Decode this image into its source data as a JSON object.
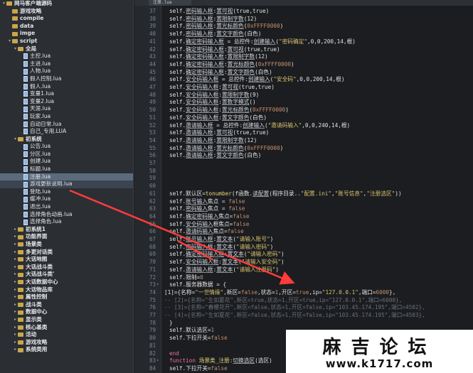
{
  "tab": {
    "label": "注册.lua"
  },
  "tree": [
    {
      "label": "网马客户端源码",
      "depth": 0,
      "type": "folder",
      "twisty": "▾",
      "bold": true
    },
    {
      "label": "游戏攻略",
      "depth": 1,
      "type": "folder",
      "twisty": "",
      "bold": true
    },
    {
      "label": "compile",
      "depth": 1,
      "type": "folder",
      "twisty": "",
      "bold": true
    },
    {
      "label": "data",
      "depth": 1,
      "type": "folder",
      "twisty": "",
      "bold": true
    },
    {
      "label": "imge",
      "depth": 1,
      "type": "folder",
      "twisty": "",
      "bold": true
    },
    {
      "label": "script",
      "depth": 1,
      "type": "folder",
      "twisty": "▾",
      "bold": true
    },
    {
      "label": "全局",
      "depth": 2,
      "type": "folder",
      "twisty": "▾",
      "bold": true
    },
    {
      "label": "主控.lua",
      "depth": 3,
      "type": "file"
    },
    {
      "label": "主进.lua",
      "depth": 3,
      "type": "file"
    },
    {
      "label": "人物.lua",
      "depth": 3,
      "type": "file"
    },
    {
      "label": "假人控制.lua",
      "depth": 3,
      "type": "file"
    },
    {
      "label": "假人.lua",
      "depth": 3,
      "type": "file"
    },
    {
      "label": "变量1.lua",
      "depth": 3,
      "type": "file"
    },
    {
      "label": "变量2.lua",
      "depth": 3,
      "type": "file"
    },
    {
      "label": "天涯.lua",
      "depth": 3,
      "type": "file"
    },
    {
      "label": "玩家.lua",
      "depth": 3,
      "type": "file"
    },
    {
      "label": "自动日常.lua",
      "depth": 3,
      "type": "file"
    },
    {
      "label": "自己_专用.LUA",
      "depth": 3,
      "type": "file"
    },
    {
      "label": "初系统",
      "depth": 2,
      "type": "folder",
      "twisty": "▾",
      "bold": true
    },
    {
      "label": "公告.lua",
      "depth": 3,
      "type": "file"
    },
    {
      "label": "分区.lua",
      "depth": 3,
      "type": "file"
    },
    {
      "label": "创建.lua",
      "depth": 3,
      "type": "file"
    },
    {
      "label": "标题.lua",
      "depth": 3,
      "type": "file"
    },
    {
      "label": "注册.lua",
      "depth": 3,
      "type": "file",
      "selected": true
    },
    {
      "label": "游戏更新说明.lua",
      "depth": 3,
      "type": "file",
      "selected2": true
    },
    {
      "label": "登陆.lua",
      "depth": 3,
      "type": "file"
    },
    {
      "label": "缓冲.lua",
      "depth": 3,
      "type": "file"
    },
    {
      "label": "退出.lua",
      "depth": 3,
      "type": "file"
    },
    {
      "label": "选择角色动画.lua",
      "depth": 3,
      "type": "file"
    },
    {
      "label": "选择角色.lua",
      "depth": 3,
      "type": "file"
    },
    {
      "label": "初系统1",
      "depth": 2,
      "type": "folder",
      "twisty": "▸",
      "bold": true
    },
    {
      "label": "功能界面",
      "depth": 2,
      "type": "folder",
      "twisty": "▸",
      "bold": true
    },
    {
      "label": "场景类",
      "depth": 2,
      "type": "folder",
      "twisty": "▸",
      "bold": true
    },
    {
      "label": "多更对话类",
      "depth": 2,
      "type": "folder",
      "twisty": "▸",
      "bold": true
    },
    {
      "label": "大话地图",
      "depth": 2,
      "type": "folder",
      "twisty": "▸",
      "bold": true
    },
    {
      "label": "大话战斗类",
      "depth": 2,
      "type": "folder",
      "twisty": "▸",
      "bold": true
    },
    {
      "label": "大话战斗类'",
      "depth": 2,
      "type": "folder",
      "twisty": "▸",
      "bold": true
    },
    {
      "label": "大话数据中心",
      "depth": 2,
      "type": "folder",
      "twisty": "▸",
      "bold": true
    },
    {
      "label": "大话物品库",
      "depth": 2,
      "type": "folder",
      "twisty": "▸",
      "bold": true
    },
    {
      "label": "属性控制",
      "depth": 2,
      "type": "folder",
      "twisty": "▸",
      "bold": true
    },
    {
      "label": "战斗类",
      "depth": 2,
      "type": "folder",
      "twisty": "▸",
      "bold": true
    },
    {
      "label": "数据中心",
      "depth": 2,
      "type": "folder",
      "twisty": "▸",
      "bold": true
    },
    {
      "label": "显示类",
      "depth": 2,
      "type": "folder",
      "twisty": "▸",
      "bold": true
    },
    {
      "label": "核心基类",
      "depth": 2,
      "type": "folder",
      "twisty": "▸",
      "bold": true
    },
    {
      "label": "活动",
      "depth": 2,
      "type": "folder",
      "twisty": "▸",
      "bold": true
    },
    {
      "label": "游戏攻略",
      "depth": 2,
      "type": "folder",
      "twisty": "▸",
      "bold": true
    },
    {
      "label": "系统类用",
      "depth": 2,
      "type": "folder",
      "twisty": "▸",
      "bold": true
    }
  ],
  "code": [
    {
      "n": "37",
      "segs": [
        [
          "self.",
          "k"
        ],
        [
          "密码输入框",
          "ul"
        ],
        [
          ":",
          "k"
        ],
        [
          "置可视",
          "ul"
        ],
        [
          "(true,true)",
          "k"
        ]
      ]
    },
    {
      "n": "38",
      "segs": [
        [
          "self.",
          "k"
        ],
        [
          "密码输入框",
          "ul"
        ],
        [
          ":",
          "k"
        ],
        [
          "置限制字数",
          "ul"
        ],
        [
          "(12)",
          "k"
        ]
      ]
    },
    {
      "n": "39",
      "segs": [
        [
          "self.",
          "k"
        ],
        [
          "密码输入框",
          "ul"
        ],
        [
          ":",
          "k"
        ],
        [
          "置光标颜色",
          "ul"
        ],
        [
          "(",
          "k"
        ],
        [
          "0xFFFF0000",
          "num"
        ],
        [
          ")",
          "k"
        ]
      ]
    },
    {
      "n": "40",
      "segs": [
        [
          "self.",
          "k"
        ],
        [
          "密码输入框",
          "ul"
        ],
        [
          ":",
          "k"
        ],
        [
          "置文字颜色",
          "ul"
        ],
        [
          "(白色)",
          "k"
        ]
      ]
    },
    {
      "n": "41",
      "segs": [
        [
          "self.",
          "k"
        ],
        [
          "确定密码输入框",
          "ul"
        ],
        [
          " = 总控件:",
          "k"
        ],
        [
          "创建输入",
          "ul"
        ],
        [
          "(",
          "k"
        ],
        [
          "\"密码确定\"",
          "str"
        ],
        [
          ",0,0,200,14,根)",
          "k"
        ]
      ]
    },
    {
      "n": "42",
      "segs": [
        [
          "self.",
          "k"
        ],
        [
          "确定密码输入框",
          "ul"
        ],
        [
          ":",
          "k"
        ],
        [
          "置可视",
          "ul"
        ],
        [
          "(true,true)",
          "k"
        ]
      ]
    },
    {
      "n": "43",
      "segs": [
        [
          "self.",
          "k"
        ],
        [
          "确定密码输入框",
          "ul"
        ],
        [
          ":",
          "k"
        ],
        [
          "置限制字数",
          "ul"
        ],
        [
          "(12)",
          "k"
        ]
      ]
    },
    {
      "n": "44",
      "segs": [
        [
          "self.",
          "k"
        ],
        [
          "确定密码输入框",
          "ul"
        ],
        [
          ":",
          "k"
        ],
        [
          "置光标颜色",
          "ul"
        ],
        [
          "(",
          "k"
        ],
        [
          "0xFFFF0000",
          "num"
        ],
        [
          ")",
          "k"
        ]
      ]
    },
    {
      "n": "45",
      "segs": [
        [
          "self.",
          "k"
        ],
        [
          "确定密码输入框",
          "ul"
        ],
        [
          ":",
          "k"
        ],
        [
          "置文字颜色",
          "ul"
        ],
        [
          "(白色)",
          "k"
        ]
      ]
    },
    {
      "n": "46",
      "segs": [
        [
          "self.",
          "k"
        ],
        [
          "安全码输入框",
          "ul"
        ],
        [
          " = 总控件:",
          "k"
        ],
        [
          "创建输入",
          "ul"
        ],
        [
          "(",
          "k"
        ],
        [
          "\"安全码\"",
          "str"
        ],
        [
          ",0,0,200,14,根)",
          "k"
        ]
      ]
    },
    {
      "n": "47",
      "segs": [
        [
          "self.",
          "k"
        ],
        [
          "安全码输入框",
          "ul"
        ],
        [
          ":",
          "k"
        ],
        [
          "置可视",
          "ul"
        ],
        [
          "(true,true)",
          "k"
        ]
      ]
    },
    {
      "n": "48",
      "segs": [
        [
          "self.",
          "k"
        ],
        [
          "安全码输入框",
          "ul"
        ],
        [
          ":",
          "k"
        ],
        [
          "置限制字数",
          "ul"
        ],
        [
          "(9)",
          "k"
        ]
      ]
    },
    {
      "n": "49",
      "segs": [
        [
          "self.",
          "k"
        ],
        [
          "安全码输入框",
          "ul"
        ],
        [
          ":",
          "k"
        ],
        [
          "置数字模式",
          "ul"
        ],
        [
          "()",
          "k"
        ]
      ]
    },
    {
      "n": "50",
      "segs": [
        [
          "self.",
          "k"
        ],
        [
          "安全码输入框",
          "ul"
        ],
        [
          ":",
          "k"
        ],
        [
          "置光标颜色",
          "ul"
        ],
        [
          "(",
          "k"
        ],
        [
          "0xFFFF0000",
          "num"
        ],
        [
          ")",
          "k"
        ]
      ]
    },
    {
      "n": "51",
      "segs": [
        [
          "self.",
          "k"
        ],
        [
          "安全码输入框",
          "ul"
        ],
        [
          ":",
          "k"
        ],
        [
          "置文字颜色",
          "ul"
        ],
        [
          "(白色)",
          "k"
        ]
      ]
    },
    {
      "n": "52",
      "segs": [
        [
          "self.",
          "k"
        ],
        [
          "邀请输入框",
          "ul"
        ],
        [
          " = 总控件:",
          "k"
        ],
        [
          "创建输入",
          "ul"
        ],
        [
          "(",
          "k"
        ],
        [
          "\"邀请码输入\"",
          "str"
        ],
        [
          ",0,0,240,14,根)",
          "k"
        ]
      ]
    },
    {
      "n": "53",
      "segs": [
        [
          "self.",
          "k"
        ],
        [
          "邀请输入框",
          "ul"
        ],
        [
          ":",
          "k"
        ],
        [
          "置可视",
          "ul"
        ],
        [
          "(true,true)",
          "k"
        ]
      ]
    },
    {
      "n": "54",
      "segs": [
        [
          "self.",
          "k"
        ],
        [
          "邀请输入框",
          "ul"
        ],
        [
          ":",
          "k"
        ],
        [
          "置限制字数",
          "ul"
        ],
        [
          "(12)",
          "k"
        ]
      ]
    },
    {
      "n": "55",
      "segs": [
        [
          "self.",
          "k"
        ],
        [
          "邀请输入框",
          "ul"
        ],
        [
          ":",
          "k"
        ],
        [
          "置光标颜色",
          "ul"
        ],
        [
          "(",
          "k"
        ],
        [
          "0xFFFF0000",
          "num"
        ],
        [
          ")",
          "k"
        ]
      ]
    },
    {
      "n": "56",
      "segs": [
        [
          "self.",
          "k"
        ],
        [
          "邀请输入框",
          "ul"
        ],
        [
          ":",
          "k"
        ],
        [
          "置文字颜色",
          "ul"
        ],
        [
          "(白色)",
          "k"
        ]
      ]
    },
    {
      "n": "57",
      "segs": []
    },
    {
      "n": "58",
      "segs": []
    },
    {
      "n": "59",
      "segs": []
    },
    {
      "n": "60",
      "segs": []
    },
    {
      "n": "61",
      "segs": [
        [
          "self.默认区=",
          "k"
        ],
        [
          "tonumber",
          "fn"
        ],
        [
          "(f函数.",
          "k"
        ],
        [
          "读配置",
          "ul"
        ],
        [
          "(程序目录..",
          "k"
        ],
        [
          "\"配置.ini\"",
          "str"
        ],
        [
          ",",
          "k"
        ],
        [
          "\"账号信息\"",
          "str"
        ],
        [
          ",",
          "k"
        ],
        [
          "\"注册选区\"",
          "str"
        ],
        [
          "))",
          "k"
        ]
      ]
    },
    {
      "n": "62",
      "segs": [
        [
          "self.",
          "k"
        ],
        [
          "账号输入",
          "ul"
        ],
        [
          "焦点 = ",
          "k"
        ],
        [
          "false",
          "num"
        ]
      ]
    },
    {
      "n": "63",
      "segs": [
        [
          "self.",
          "k"
        ],
        [
          "密码输入",
          "ul"
        ],
        [
          "焦点 = ",
          "k"
        ],
        [
          "false",
          "num"
        ]
      ]
    },
    {
      "n": "64",
      "segs": [
        [
          "self.",
          "k"
        ],
        [
          "确定密码输入",
          "ul"
        ],
        [
          "焦点=",
          "k"
        ],
        [
          "false",
          "num"
        ]
      ]
    },
    {
      "n": "65",
      "segs": [
        [
          "self.",
          "k"
        ],
        [
          "安全码输入",
          "ul"
        ],
        [
          "框焦点=",
          "k"
        ],
        [
          "false",
          "num"
        ]
      ]
    },
    {
      "n": "66",
      "segs": [
        [
          "self.",
          "k"
        ],
        [
          "邀请码输入",
          "ul"
        ],
        [
          "焦点=",
          "k"
        ],
        [
          "false",
          "num"
        ]
      ]
    },
    {
      "n": "67",
      "segs": [
        [
          "self.",
          "k"
        ],
        [
          "账号输入框",
          "ul"
        ],
        [
          ":",
          "k"
        ],
        [
          "置文本",
          "ul"
        ],
        [
          "(",
          "k"
        ],
        [
          "\"请输入账号\"",
          "str"
        ],
        [
          ")",
          "k"
        ]
      ]
    },
    {
      "n": "68",
      "segs": [
        [
          "self.",
          "k"
        ],
        [
          "密码输入框",
          "ul"
        ],
        [
          ":",
          "k"
        ],
        [
          "置文本",
          "ul"
        ],
        [
          "(",
          "k"
        ],
        [
          "\"请输入密码\"",
          "str"
        ],
        [
          ")",
          "k"
        ]
      ]
    },
    {
      "n": "69",
      "segs": [
        [
          "self.",
          "k"
        ],
        [
          "确定密码输入框",
          "ul"
        ],
        [
          ":",
          "k"
        ],
        [
          "置文本",
          "ul"
        ],
        [
          "(",
          "k"
        ],
        [
          "\"请输入密码\"",
          "str"
        ],
        [
          ")",
          "k"
        ]
      ]
    },
    {
      "n": "70",
      "segs": [
        [
          "self.",
          "k"
        ],
        [
          "安全码输入框",
          "ul"
        ],
        [
          ":",
          "k"
        ],
        [
          "置文本",
          "ul"
        ],
        [
          "(",
          "k"
        ],
        [
          "\"请输入安全码\"",
          "str"
        ],
        [
          ")",
          "k"
        ]
      ]
    },
    {
      "n": "71",
      "segs": [
        [
          "self.",
          "k"
        ],
        [
          "邀请输入框",
          "ul"
        ],
        [
          ":",
          "k"
        ],
        [
          "置文本",
          "ul"
        ],
        [
          "(",
          "k"
        ],
        [
          "\"请输入注册码\"",
          "str"
        ],
        [
          ")",
          "k"
        ]
      ]
    },
    {
      "n": "72",
      "segs": [
        [
          "self.限制=",
          "k"
        ],
        [
          "0",
          "num"
        ]
      ]
    },
    {
      "n": "73",
      "segs": [
        [
          "self.服务器数据 = {",
          "k"
        ]
      ],
      "fold": "▾"
    },
    {
      "n": "74",
      "segs": [
        [
          "[1]={名称=",
          "k"
        ],
        [
          "\"一世情缘\"",
          "str"
        ],
        [
          ",新区=",
          "k"
        ],
        [
          "false",
          "num"
        ],
        [
          ",状态=",
          "k"
        ],
        [
          "1",
          "num"
        ],
        [
          ",开区=",
          "k"
        ],
        [
          "true",
          "num"
        ],
        [
          ",ip=",
          "k"
        ],
        [
          "\"127.0.0.1\"",
          "str"
        ],
        [
          ",端口=",
          "k"
        ],
        [
          "6000",
          "num"
        ],
        [
          "},",
          "k"
        ]
      ]
    },
    {
      "n": "75",
      "segs": [
        [
          "-- [2]={名称=\"生如夏花\",新区=true,状态=1,开区=true,ip=\"127.0.0.1\",端口=6000},",
          "cm"
        ]
      ]
    },
    {
      "n": "76",
      "segs": [
        [
          "-- [3]={名称=\"春暖花开\",新区=false,状态=1,开区=false,ip=\"103.45.174.195\",端口=4502},",
          "cm"
        ]
      ]
    },
    {
      "n": "77",
      "segs": [
        [
          "-- [4]={名称=\"生如夏花\",新区=false,状态=1,开区=false,ip=\"103.45.174.195\",端口=4503},",
          "cm"
        ]
      ]
    },
    {
      "n": "78",
      "segs": [
        [
          "}",
          "k"
        ]
      ]
    },
    {
      "n": "79",
      "segs": [
        [
          "self.默认选区=",
          "k"
        ],
        [
          "1",
          "num"
        ]
      ]
    },
    {
      "n": "80",
      "segs": [
        [
          "self.下拉开关=",
          "k"
        ],
        [
          "false",
          "num"
        ]
      ]
    },
    {
      "n": "81",
      "segs": []
    },
    {
      "n": "82",
      "segs": [
        [
          "end",
          "kw"
        ]
      ]
    },
    {
      "n": "83",
      "segs": [
        [
          "function ",
          "kw"
        ],
        [
          "场景类_注册:",
          "fn"
        ],
        [
          "切换选区",
          "ul"
        ],
        [
          "(选区)",
          "k"
        ]
      ],
      "fold": "▾"
    },
    {
      "n": "84",
      "segs": [
        [
          "self.下拉开关=",
          "k"
        ],
        [
          "false",
          "num"
        ]
      ]
    },
    {
      "n": "85",
      "segs": [
        [
          "self.默认选区=选区",
          "k"
        ]
      ]
    }
  ],
  "watermark": {
    "title": "麻吉论坛",
    "url": "www.k1717.com"
  },
  "colors": {
    "arrow": "#ff3b3b",
    "selected_row": "#5b6b7d"
  }
}
